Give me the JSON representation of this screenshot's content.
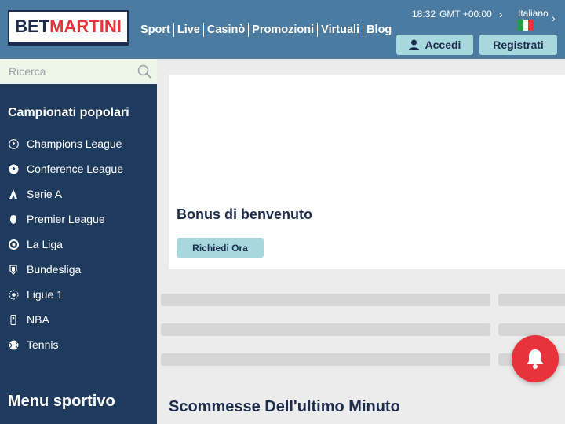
{
  "header": {
    "logo_bet": "BET",
    "logo_martini": "MARTINI",
    "nav": [
      "Sport",
      "Live",
      "Casinò",
      "Promozioni",
      "Virtuali",
      "Blog"
    ],
    "time": "18:32",
    "timezone": "GMT +00:00",
    "language": "Italiano",
    "login_label": "Accedi",
    "register_label": "Registrati"
  },
  "sidebar": {
    "search_placeholder": "Ricerca",
    "popular_title": "Campionati popolari",
    "popular": [
      {
        "label": "Champions League",
        "icon": "champions-league-icon"
      },
      {
        "label": "Conference League",
        "icon": "conference-league-icon"
      },
      {
        "label": "Serie A",
        "icon": "serie-a-icon"
      },
      {
        "label": "Premier League",
        "icon": "premier-league-icon"
      },
      {
        "label": "La Liga",
        "icon": "la-liga-icon"
      },
      {
        "label": "Bundesliga",
        "icon": "bundesliga-icon"
      },
      {
        "label": "Ligue 1",
        "icon": "ligue-1-icon"
      },
      {
        "label": "NBA",
        "icon": "nba-icon"
      },
      {
        "label": "Tennis",
        "icon": "tennis-icon"
      }
    ],
    "sport_menu_title": "Menu sportivo"
  },
  "main": {
    "promo_title": "Bonus di benvenuto",
    "promo_button": "Richiedi Ora",
    "section_title": "Scommesse Dell'ultimo Minuto"
  },
  "colors": {
    "header_bg": "#4b7ba0",
    "sidebar_bg": "#1e3a5c",
    "accent_button": "#a7d8dd",
    "brand_red": "#e8323c",
    "brand_navy": "#1e2d4e"
  }
}
